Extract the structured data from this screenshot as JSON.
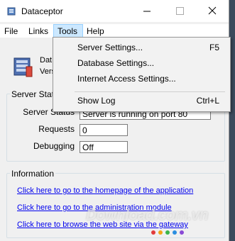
{
  "window": {
    "title": "Dataceptor"
  },
  "menubar": {
    "file": "File",
    "links": "Links",
    "tools": "Tools",
    "help": "Help"
  },
  "tools_menu": {
    "items": [
      {
        "label": "Server Settings...",
        "shortcut": "F5"
      },
      {
        "label": "Database Settings...",
        "shortcut": ""
      },
      {
        "label": "Internet Access Settings...",
        "shortcut": ""
      },
      {
        "label": "Show Log",
        "shortcut": "Ctrl+L"
      }
    ]
  },
  "app_info": {
    "name_partial": "Dat",
    "version_partial": "Vers"
  },
  "server_status": {
    "group_label": "Server Statu",
    "status_label": "Server Status",
    "status_value": "Server is running on port 80",
    "requests_label": "Requests",
    "requests_value": "0",
    "debugging_label": "Debugging",
    "debugging_value": "Off"
  },
  "information": {
    "group_label": "Information",
    "links": [
      "Click here to go to the homepage of the application",
      "Click here to go to the administration module",
      "Click here to browse the web site via the gateway"
    ]
  },
  "watermark": {
    "text": "Download.com.vn"
  },
  "colors": {
    "menu_highlight": "#cce8ff",
    "link": "#0000ee",
    "window_bg": "#f0f0f0"
  }
}
